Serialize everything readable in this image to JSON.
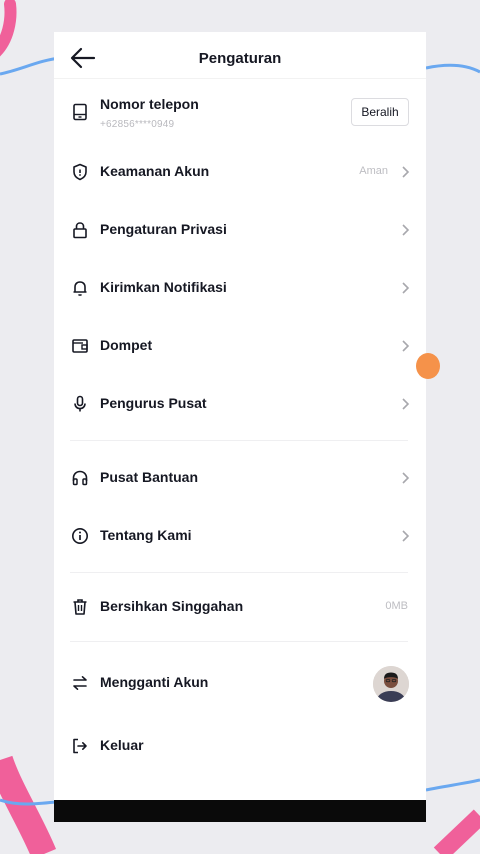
{
  "header": {
    "title": "Pengaturan"
  },
  "account": {
    "phone_label": "Nomor telepon",
    "phone_number": "+62856****0949",
    "switch_label": "Beralih"
  },
  "menu": {
    "security": {
      "label": "Keamanan Akun",
      "value": "Aman"
    },
    "privacy": {
      "label": "Pengaturan Privasi"
    },
    "notifications": {
      "label": "Kirimkan Notifikasi"
    },
    "wallet": {
      "label": "Dompet"
    },
    "admin": {
      "label": "Pengurus Pusat"
    },
    "help": {
      "label": "Pusat Bantuan"
    },
    "about": {
      "label": "Tentang Kami"
    },
    "cache": {
      "label": "Bersihkan Singgahan",
      "value": "0MB"
    },
    "switch_account": {
      "label": "Mengganti Akun"
    },
    "logout": {
      "label": "Keluar"
    }
  },
  "icons": [
    "back-arrow-icon",
    "phone-icon",
    "shield-icon",
    "lock-icon",
    "bell-icon",
    "wallet-icon",
    "microphone-icon",
    "headset-icon",
    "info-icon",
    "trash-icon",
    "swap-icon",
    "logout-icon",
    "chevron-right-icon"
  ],
  "colors": {
    "text": "#161823",
    "muted": "#bdbdc2",
    "accent_decor": "#f0609a",
    "decor_line": "#6aa8f0"
  }
}
